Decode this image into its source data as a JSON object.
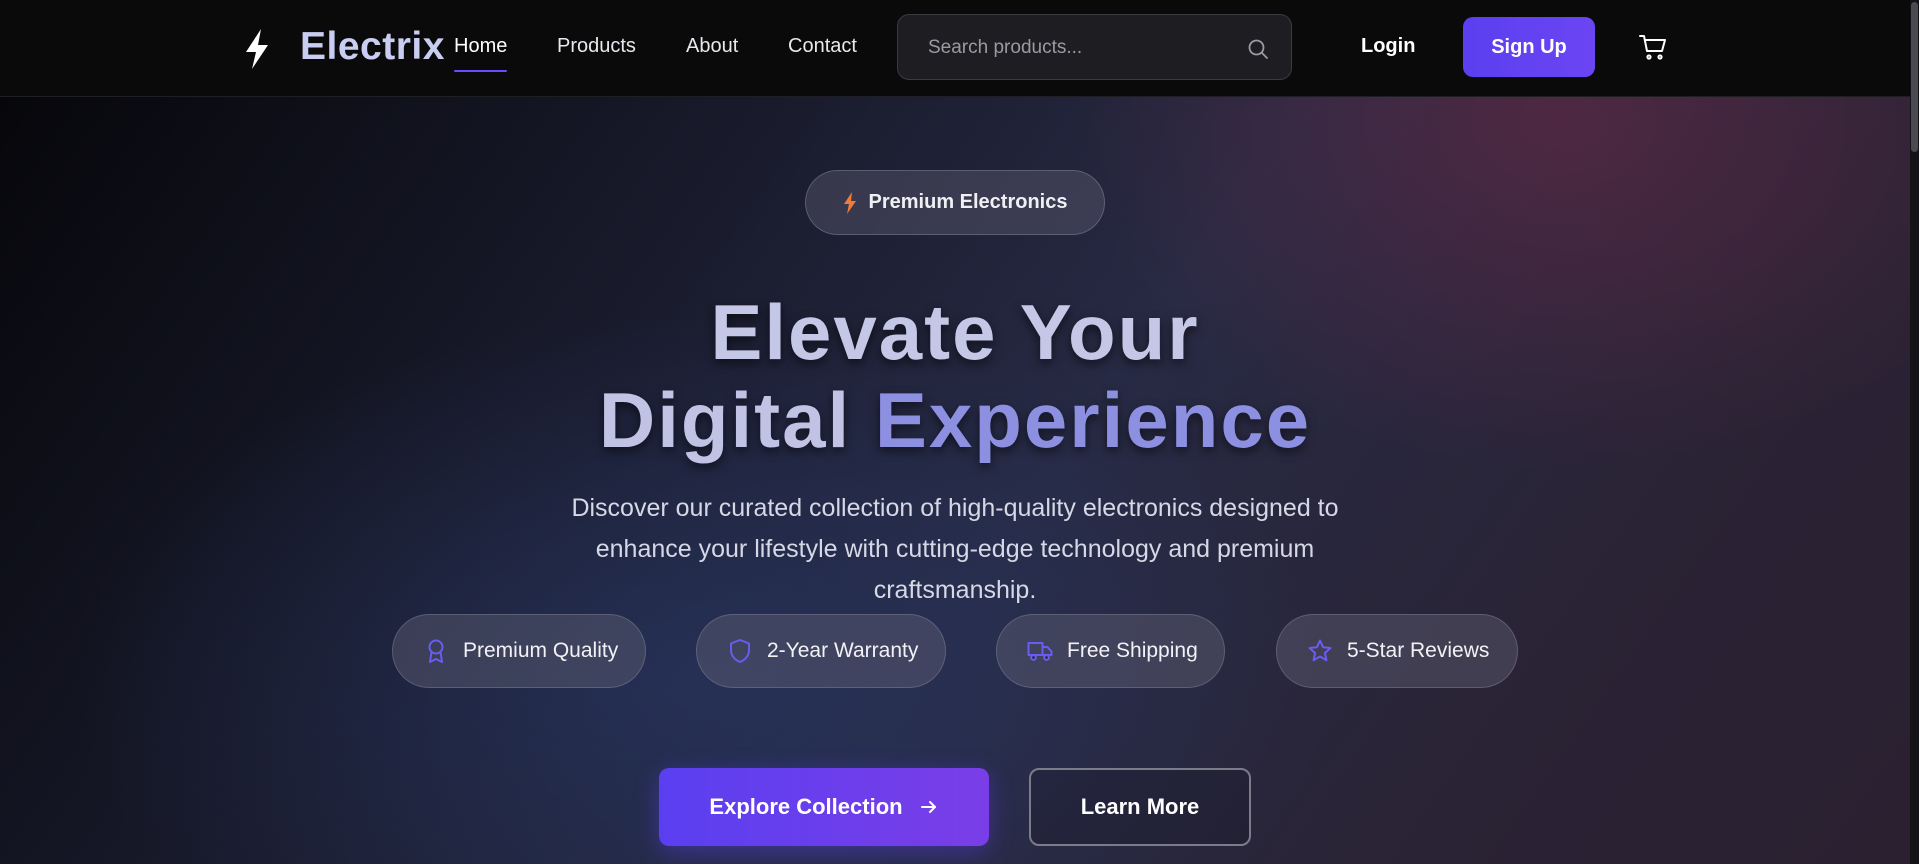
{
  "brand": {
    "name": "Electrix"
  },
  "nav": {
    "links": [
      {
        "label": "Home",
        "active": true
      },
      {
        "label": "Products"
      },
      {
        "label": "About"
      },
      {
        "label": "Contact"
      }
    ],
    "search_placeholder": "Search products...",
    "login_label": "Login",
    "signup_label": "Sign Up"
  },
  "hero": {
    "badge": "Premium Electronics",
    "headline_line1": "Elevate Your",
    "headline_line2a": "Digital",
    "headline_line2b": "Experience",
    "subtitle": "Discover our curated collection of high-quality electronics designed to enhance your lifestyle with cutting-edge technology and premium craftsmanship.",
    "features": [
      {
        "label": "Premium Quality",
        "icon": "award-icon"
      },
      {
        "label": "2-Year Warranty",
        "icon": "shield-icon"
      },
      {
        "label": "Free Shipping",
        "icon": "truck-icon"
      },
      {
        "label": "5-Star Reviews",
        "icon": "star-icon"
      }
    ],
    "primary_cta": "Explore Collection",
    "secondary_cta": "Learn More"
  },
  "colors": {
    "accent": "#5b3ff0",
    "badge_bolt": "#f07a3a",
    "feature_icon": "#6a5cf0"
  }
}
